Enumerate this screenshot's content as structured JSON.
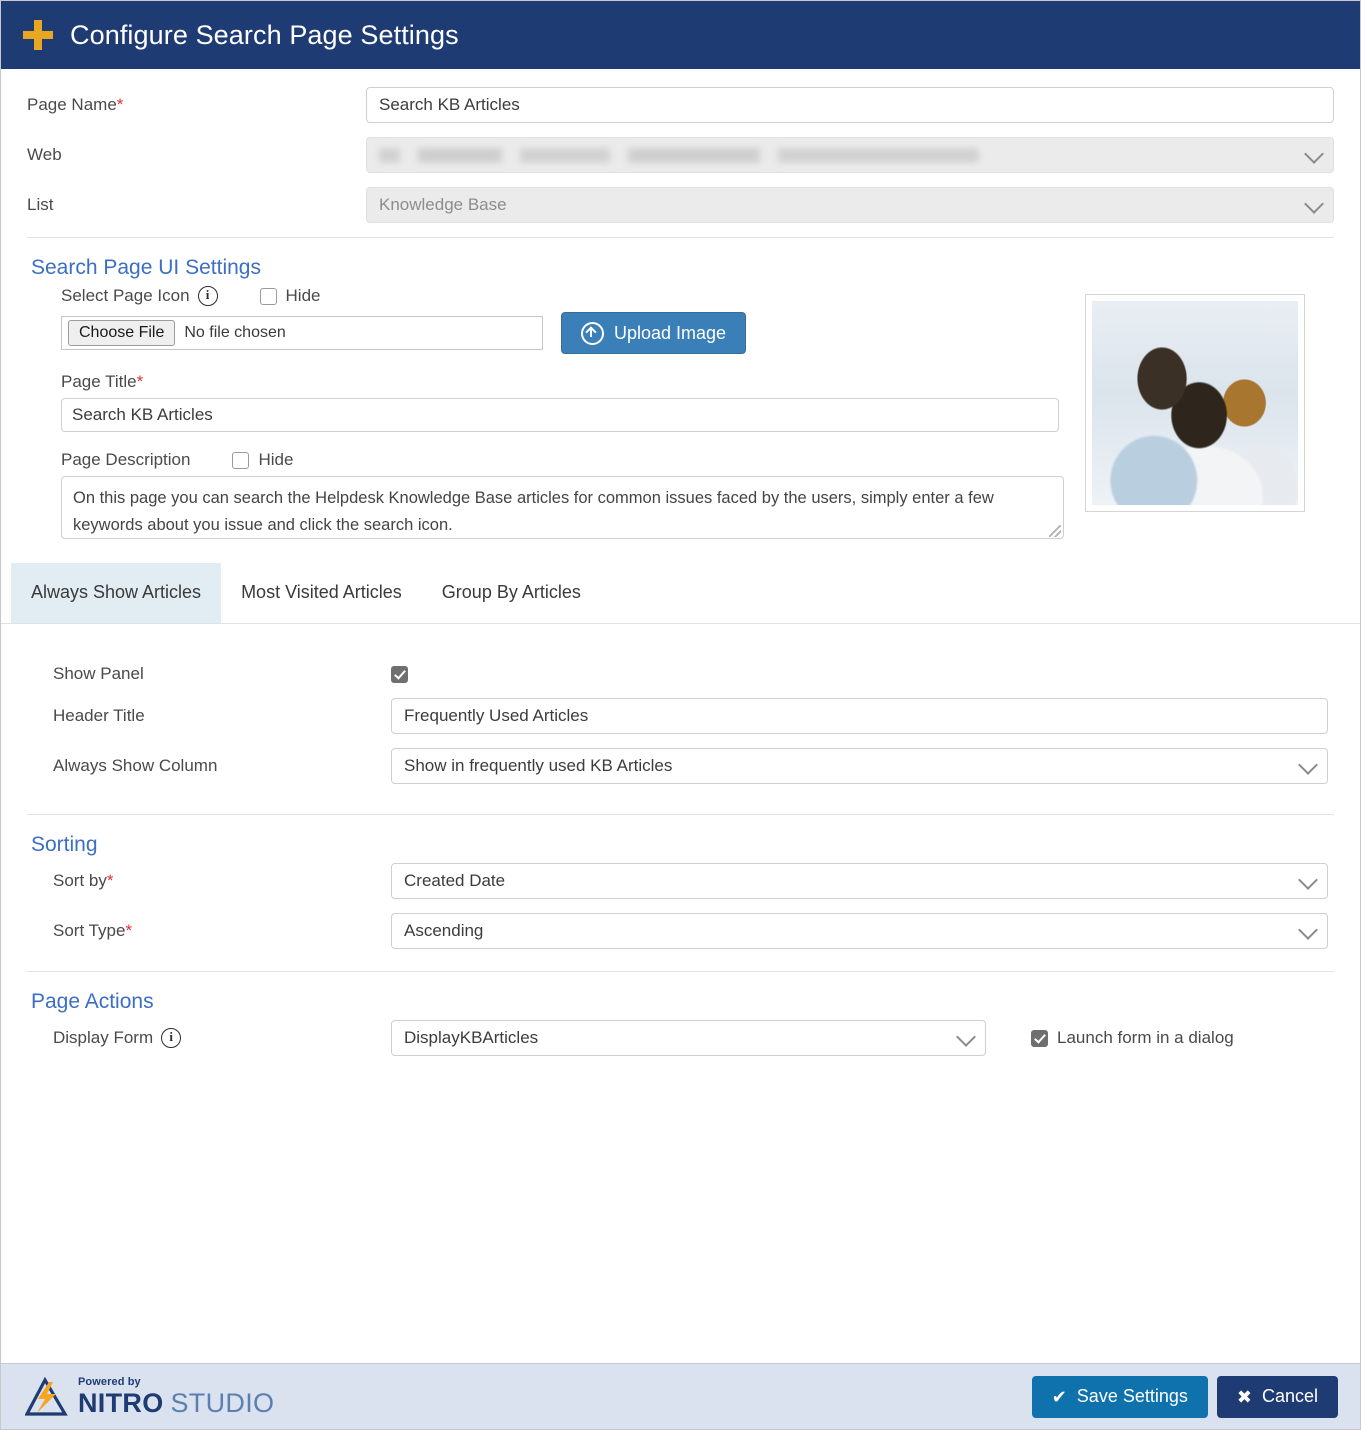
{
  "header": {
    "title": "Configure Search Page Settings",
    "icon": "plus-icon"
  },
  "top_fields": {
    "page_name": {
      "label": "Page Name",
      "required": "*",
      "value": "Search KB Articles"
    },
    "web": {
      "label": "Web",
      "value": "",
      "redacted": true
    },
    "list": {
      "label": "List",
      "value": "Knowledge Base"
    }
  },
  "ui_settings": {
    "section_title": "Search Page UI Settings",
    "select_page_icon": {
      "label": "Select Page Icon",
      "hide_label": "Hide",
      "hide_checked": false,
      "choose_file_button": "Choose File",
      "file_status": "No file chosen",
      "upload_button": "Upload Image"
    },
    "page_title": {
      "label": "Page Title",
      "required": "*",
      "value": "Search KB Articles"
    },
    "page_description": {
      "label": "Page Description",
      "hide_label": "Hide",
      "hide_checked": false,
      "value": "On this page you can search the Helpdesk Knowledge Base articles for common issues faced by the users, simply enter a few keywords about you issue and click the search icon."
    }
  },
  "tabs": [
    {
      "label": "Always Show Articles",
      "active": true
    },
    {
      "label": "Most Visited Articles",
      "active": false
    },
    {
      "label": "Group By Articles",
      "active": false
    }
  ],
  "always_show_articles": {
    "show_panel": {
      "label": "Show Panel",
      "checked": true
    },
    "header_title": {
      "label": "Header Title",
      "value": "Frequently Used Articles"
    },
    "always_show_column": {
      "label": "Always Show Column",
      "value": "Show in frequently used KB Articles"
    }
  },
  "sorting": {
    "section_title": "Sorting",
    "sort_by": {
      "label": "Sort by",
      "required": "*",
      "value": "Created Date"
    },
    "sort_type": {
      "label": "Sort Type",
      "required": "*",
      "value": "Ascending"
    }
  },
  "page_actions": {
    "section_title": "Page Actions",
    "display_form": {
      "label": "Display Form",
      "value": "DisplayKBArticles"
    },
    "launch_dialog": {
      "label": "Launch form in a dialog",
      "checked": true
    }
  },
  "footer": {
    "powered_by": "Powered by",
    "brand_primary": "NITRO",
    "brand_secondary": "STUDIO",
    "save_button": "Save Settings",
    "save_icon": "check-icon",
    "cancel_button": "Cancel",
    "cancel_icon": "close-icon"
  },
  "colors": {
    "header_navy": "#1f3b73",
    "accent_gold": "#e8a722",
    "link_blue": "#3b6fc4",
    "primary_blue": "#3b7fb8",
    "save_blue": "#0f72ad",
    "footer_bg": "#dbe2ef",
    "required_red": "#e03030"
  }
}
